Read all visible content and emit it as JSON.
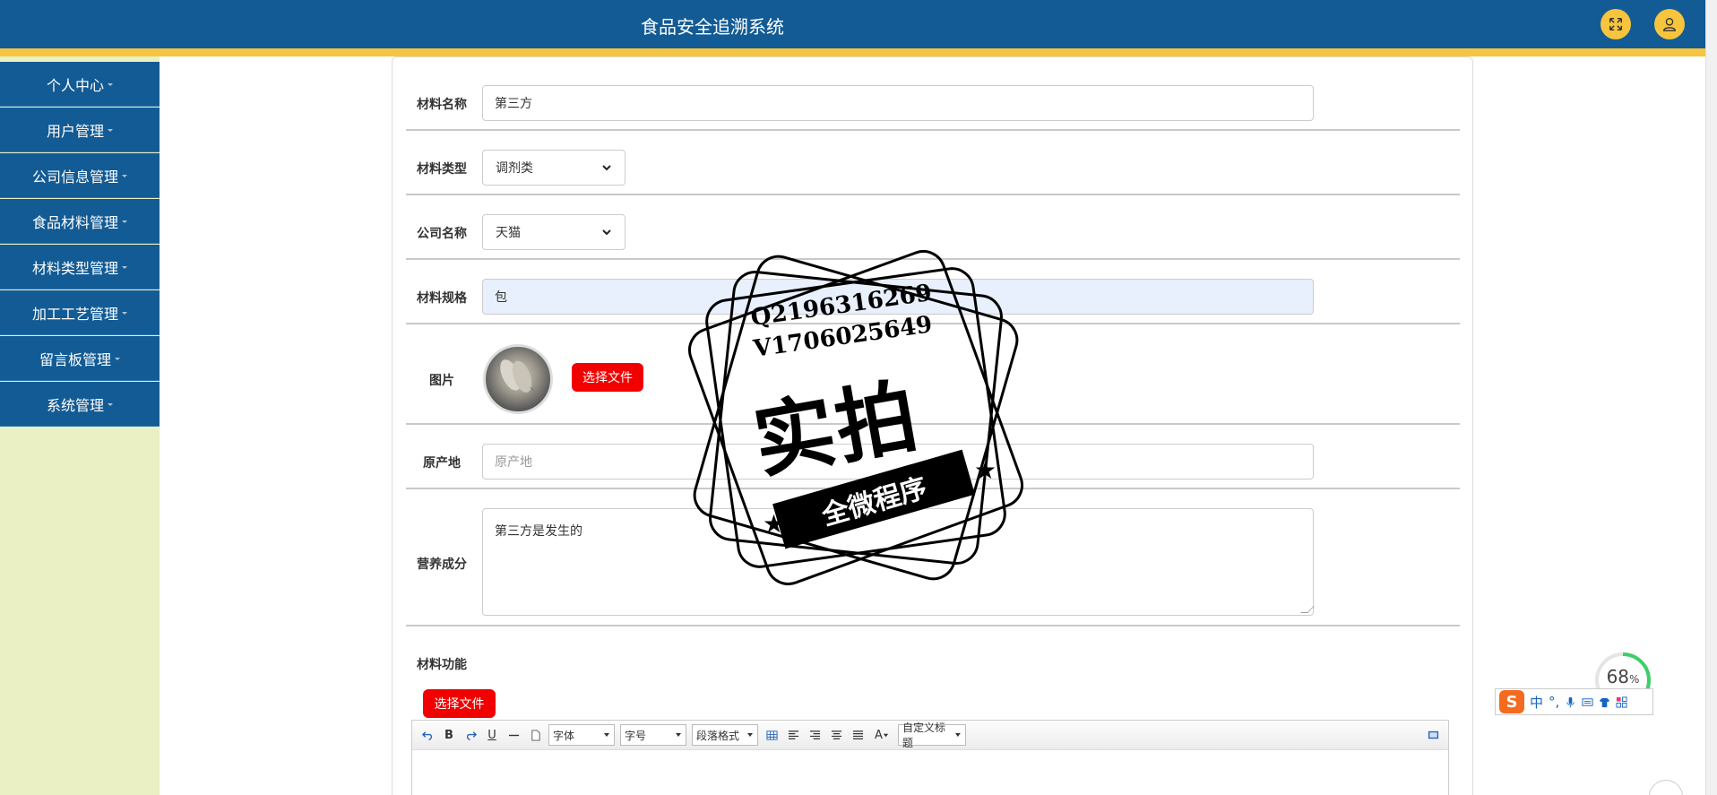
{
  "app": {
    "title": "食品安全追溯系统"
  },
  "header": {
    "fullscreen_icon": "expand-arrows-icon",
    "user_icon": "user-icon"
  },
  "sidebar": {
    "items": [
      {
        "label": "个人中心"
      },
      {
        "label": "用户管理"
      },
      {
        "label": "公司信息管理"
      },
      {
        "label": "食品材料管理"
      },
      {
        "label": "材料类型管理"
      },
      {
        "label": "加工工艺管理"
      },
      {
        "label": "留言板管理"
      },
      {
        "label": "系统管理"
      }
    ]
  },
  "form": {
    "material_name": {
      "label": "材料名称",
      "value": "第三方"
    },
    "material_type": {
      "label": "材料类型",
      "value": "调剂类"
    },
    "company_name": {
      "label": "公司名称",
      "value": "天猫"
    },
    "material_spec": {
      "label": "材料规格",
      "value": "包"
    },
    "image": {
      "label": "图片",
      "button": "选择文件"
    },
    "origin": {
      "label": "原产地",
      "placeholder": "原产地"
    },
    "nutrition": {
      "label": "营养成分",
      "value": "第三方是发生的"
    },
    "function": {
      "label": "材料功能",
      "button": "选择文件"
    }
  },
  "editor": {
    "toolbar": {
      "font_family": "字体",
      "font_size": "字号",
      "paragraph": "段落格式",
      "custom_title": "自定义标题",
      "bold": "B",
      "underline": "U",
      "font_color": "A"
    }
  },
  "watermark": {
    "line1": "Q2196316269",
    "line2": "V1706025649",
    "big": "实拍",
    "ribbon": "全微程序"
  },
  "ime": {
    "label": "中"
  },
  "progress": {
    "percent": "68",
    "unit": "%"
  },
  "colors": {
    "primary": "#135b94",
    "accent": "#f5c542",
    "sidebar_bg": "#eaefc4",
    "danger": "#f20000"
  }
}
